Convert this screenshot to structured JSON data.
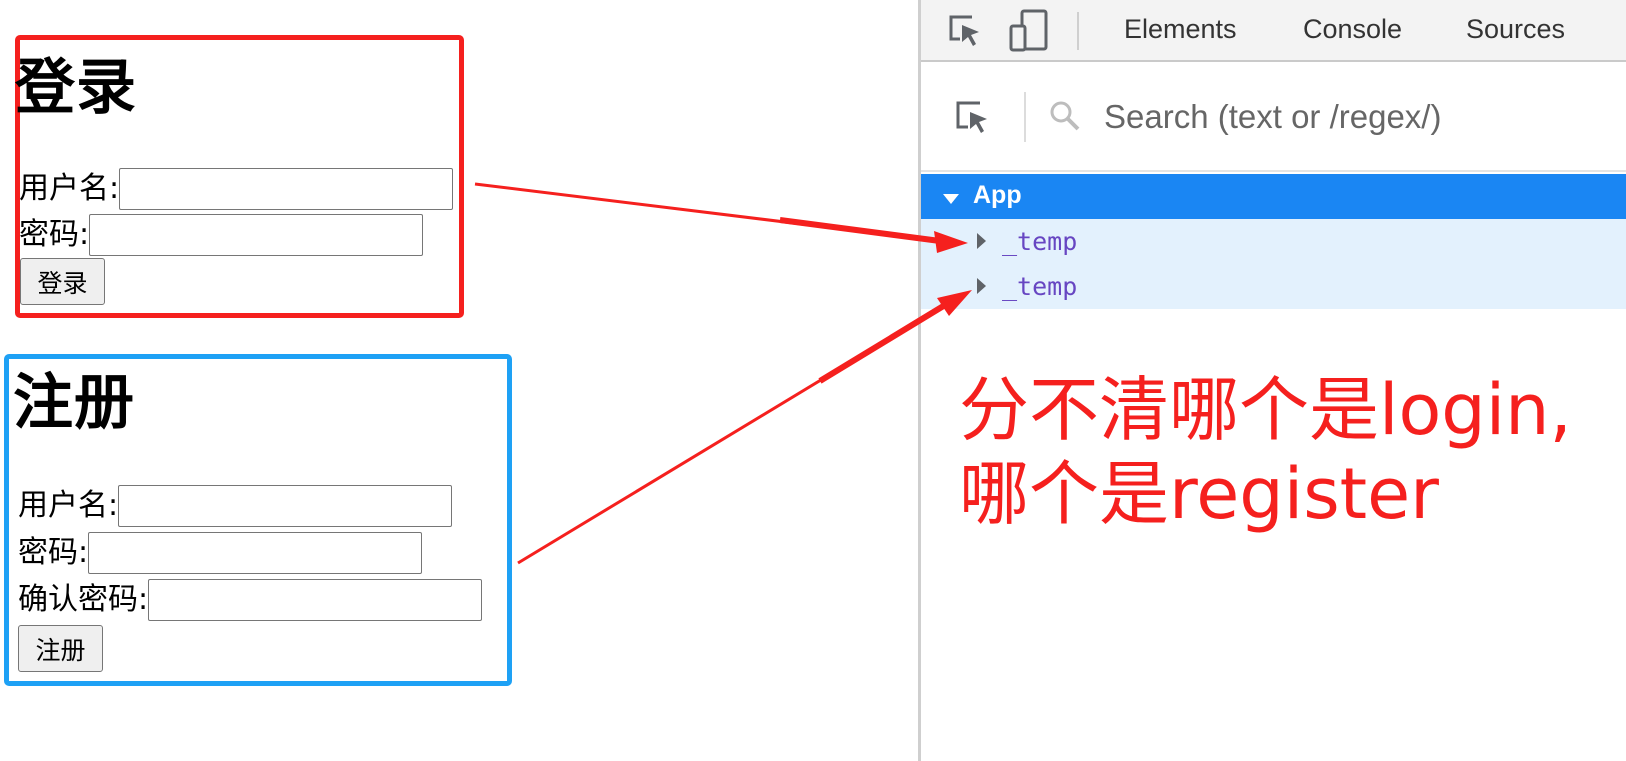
{
  "login": {
    "title": "登录",
    "username_label": "用户名:",
    "password_label": "密码:",
    "button": "登录"
  },
  "register": {
    "title": "注册",
    "username_label": "用户名:",
    "password_label": "密码:",
    "confirm_label": "确认密码:",
    "button": "注册"
  },
  "devtools": {
    "tabs": [
      "Elements",
      "Console",
      "Sources"
    ],
    "search_placeholder": "Search (text or /regex/)",
    "tree": {
      "root": "App",
      "children": [
        "_temp",
        "_temp"
      ]
    }
  },
  "annotation": "分不清哪个是login,哪个是register",
  "colors": {
    "login_border": "#f5201e",
    "register_border": "#1ea1f5",
    "arrow": "#f5201e",
    "selected_row": "#1a86f3",
    "child_row": "#e3f1fd",
    "component_name": "#6746c2",
    "annotation_text": "#f5201e"
  },
  "icons": [
    "inspect-element-icon",
    "device-toolbar-icon",
    "select-component-icon",
    "search-icon",
    "expand-triangle-icon",
    "collapse-triangle-icon",
    "arrow-annotation"
  ]
}
